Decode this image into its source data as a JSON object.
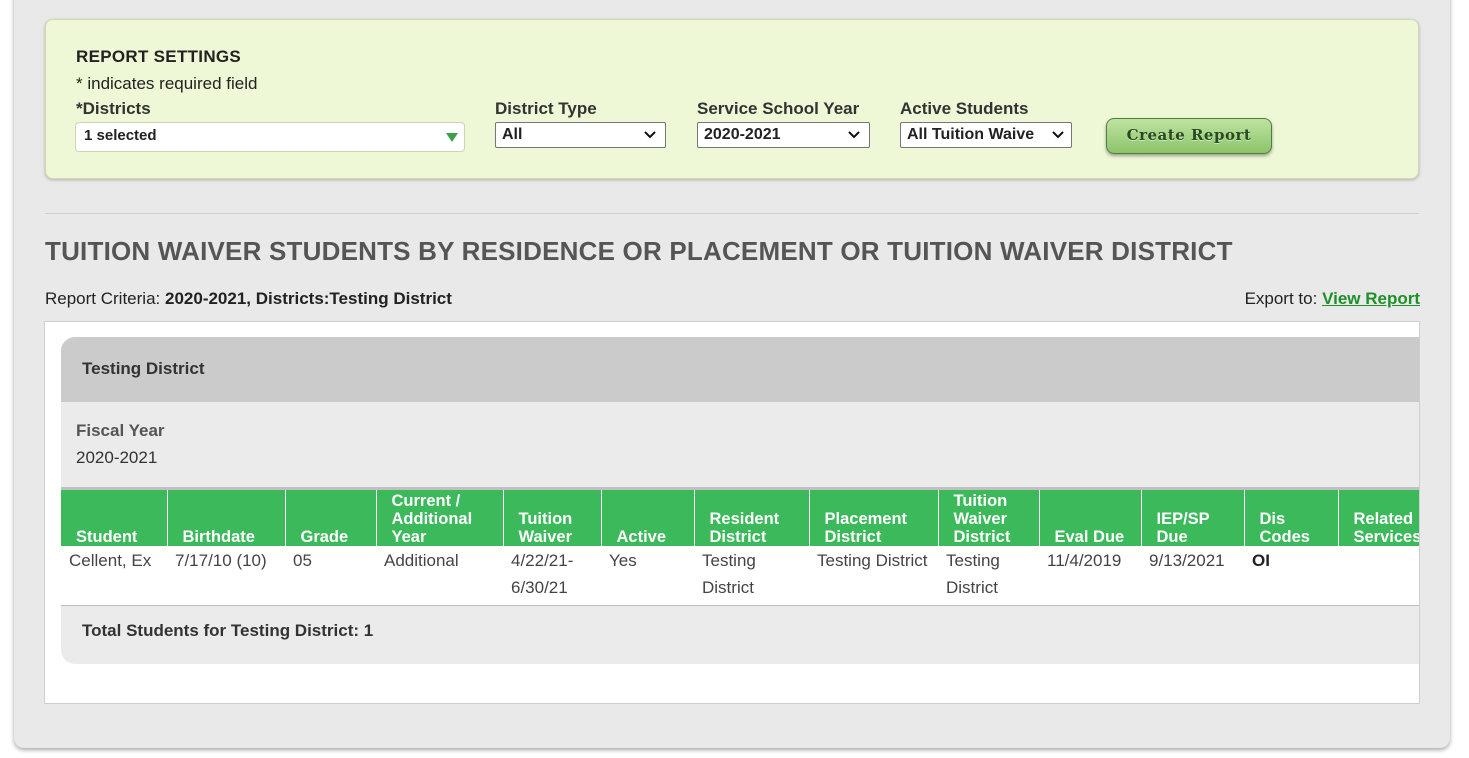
{
  "settings": {
    "title": "REPORT SETTINGS",
    "required_note": "* indicates required field",
    "districts": {
      "required_mark": "*",
      "label": "Districts",
      "value": "1 selected"
    },
    "district_type": {
      "label": "District Type",
      "value": "All"
    },
    "service_school_year": {
      "label": "Service School Year",
      "value": "2020-2021"
    },
    "active_students": {
      "label": "Active Students",
      "value": "All Tuition Waive"
    },
    "create_button": "Create Report"
  },
  "report": {
    "title": "TUITION WAIVER STUDENTS BY RESIDENCE OR PLACEMENT OR TUITION WAIVER DISTRICT",
    "criteria_label": "Report Criteria:",
    "criteria_value": "2020-2021, Districts:Testing District",
    "export_label": "Export to:",
    "export_link": "View Report",
    "group": {
      "name": "Testing District",
      "fiscal_year_label": "Fiscal Year",
      "fiscal_year_value": "2020-2021",
      "columns": [
        "Student",
        "Birthdate",
        "Grade",
        "Current / Additional Year",
        "Tuition Waiver",
        "Active",
        "Resident District",
        "Placement District",
        "Tuition Waiver District",
        "Eval Due",
        "IEP/SP Due",
        "Dis Codes",
        "Related Services"
      ],
      "rows": [
        {
          "student": "Cellent, Ex",
          "birthdate": "7/17/10 (10)",
          "grade": "05",
          "current_additional_year": "Additional",
          "tuition_waiver": "4/22/21-6/30/21",
          "active": "Yes",
          "resident_district": "Testing District",
          "placement_district": "Testing District",
          "tuition_waiver_district": "Testing District",
          "eval_due": "11/4/2019",
          "iep_sp_due": "9/13/2021",
          "dis_codes": "OI",
          "related_services": ""
        }
      ],
      "total": "Total Students for Testing District: 1"
    }
  }
}
